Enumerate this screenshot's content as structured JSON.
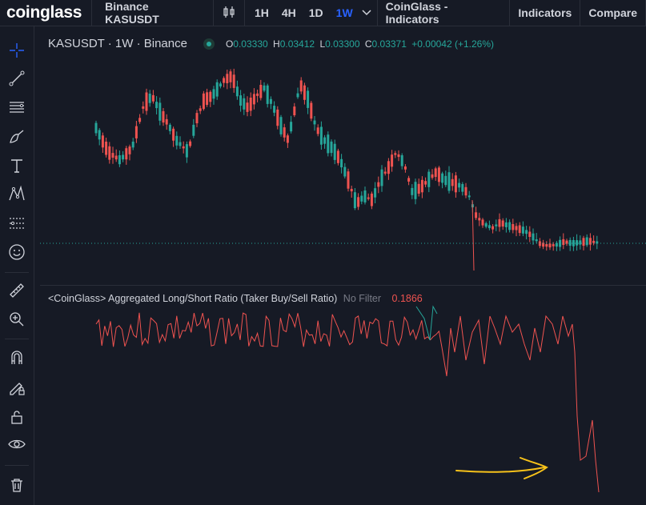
{
  "header": {
    "logo": "coinglass",
    "symbol": "Binance KASUSDT",
    "intervals": [
      "1H",
      "4H",
      "1D",
      "1W"
    ],
    "active_interval": "1W",
    "indicators_menu": "CoinGlass - Indicators",
    "indicators": "Indicators",
    "compare": "Compare"
  },
  "toolbar": {
    "icons": [
      "crosshair-icon",
      "trend-line-icon",
      "horizontal-lines-icon",
      "brush-icon",
      "text-icon",
      "pattern-icon",
      "fib-icon",
      "emoji-icon",
      "ruler-icon",
      "zoom-icon",
      "magnet-icon",
      "lock-draw-icon",
      "lock-icon",
      "eye-icon",
      "trash-icon"
    ]
  },
  "price_pane": {
    "title": "KASUSDT · 1W · Binance",
    "open_label": "O",
    "open": "0.03330",
    "high_label": "H",
    "high": "0.03412",
    "low_label": "L",
    "low": "0.03300",
    "close_label": "C",
    "close": "0.03371",
    "change": "+0.00042 (+1.26%)",
    "colors": {
      "up": "#26a69a",
      "down": "#ef5350"
    }
  },
  "indicator_pane": {
    "title": "<CoinGlass> Aggregated Long/Short Ratio (Taker Buy/Sell Ratio)",
    "filter": "No Filter",
    "value": "0.1866",
    "line_color": "#ef5350"
  },
  "annotation": {
    "arrow_color": "#f7c21a"
  }
}
